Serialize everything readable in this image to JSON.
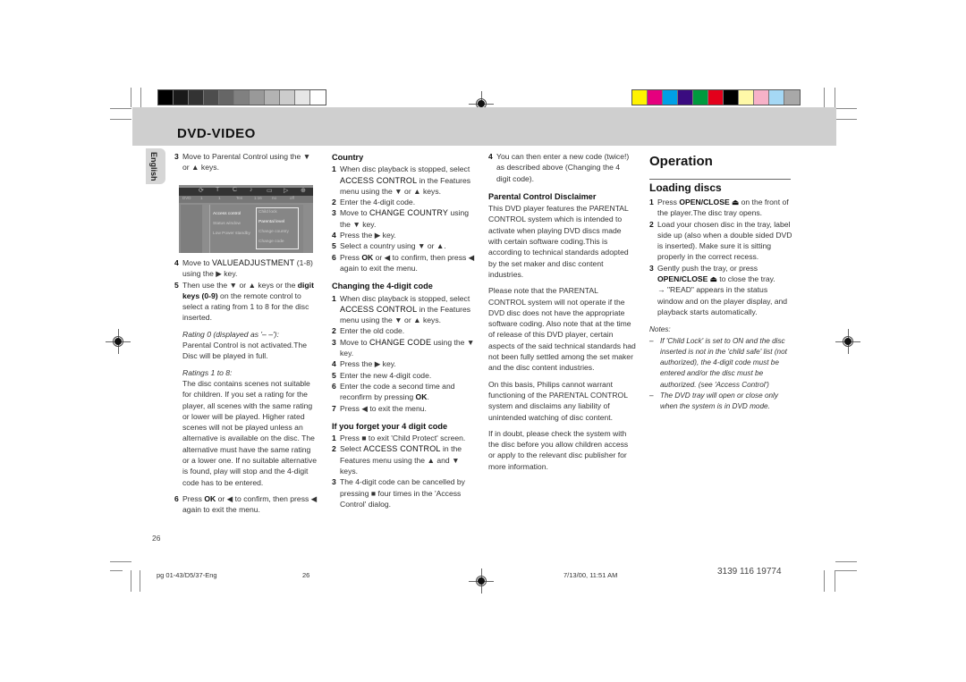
{
  "header": {
    "section_title": "DVD-VIDEO",
    "language_tab": "English",
    "grayscale_swatches": [
      "#000000",
      "#1a1a1a",
      "#333333",
      "#4d4d4d",
      "#666666",
      "#808080",
      "#999999",
      "#b3b3b3",
      "#cccccc",
      "#e6e6e6",
      "#ffffff"
    ],
    "color_swatches": [
      "#fff200",
      "#e5007e",
      "#00a0e6",
      "#3a0b80",
      "#009a3e",
      "#e3001b",
      "#000000",
      "#fff9a8",
      "#f7b2c8",
      "#a5d8f5",
      "#a8a8a8"
    ]
  },
  "col1": {
    "step3": {
      "n": "3",
      "text": "Move to Parental Control using the ▼ or ▲ keys."
    },
    "osd": {
      "top_icons": [
        "⟳",
        "T",
        "C",
        "♪",
        "▭",
        "▷",
        "⊕"
      ],
      "sub_values": [
        "DVD",
        "1",
        "1",
        "Ten",
        "1:16",
        "no",
        "off"
      ],
      "menu_items": [
        "Access control",
        "Status window",
        "Low Power standby"
      ],
      "submenu_items": [
        "Child lock",
        "Parental level",
        "Change country",
        "Change code"
      ],
      "selected_submenu": "Parental level"
    },
    "step4": {
      "n": "4",
      "pre": "Move to ",
      "key": "VALUEADJUSTMENT",
      "post": " (1-8) using the ▶ key."
    },
    "step5": {
      "n": "5",
      "pre": "Then use the ▼ or ▲ keys or the ",
      "key": "digit keys (0-9)",
      "post": " on the remote control to select a rating from 1 to 8 for the disc inserted."
    },
    "rating0_label": "Rating 0 (displayed as '– –'):",
    "rating0_text": "Parental Control is not activated.The Disc will be played in full.",
    "ratings_label": "Ratings 1 to 8:",
    "ratings_text": "The disc contains scenes not suitable for children. If you set a rating for the player, all scenes with the same rating or lower will be played. Higher rated scenes will not be played unless an alternative is available on the disc. The alternative must have the same rating or a lower one. If no suitable alternative is found, play will stop and the 4-digit code has to be entered.",
    "step6": {
      "n": "6",
      "pre": "Press ",
      "key": "OK",
      "post": " or ◀ to confirm, then press ◀ again to exit the menu."
    },
    "page_number": "26"
  },
  "col2": {
    "country_title": "Country",
    "country_steps": [
      {
        "n": "1",
        "pre": "When disc playback is stopped, select ",
        "key": "ACCESS CONTROL",
        "post": " in the Features menu using the ▼ or ▲ keys."
      },
      {
        "n": "2",
        "pre": "Enter the 4-digit code.",
        "key": "",
        "post": ""
      },
      {
        "n": "3",
        "pre": "Move to ",
        "key": "CHANGE COUNTRY",
        "post": " using the ▼ key."
      },
      {
        "n": "4",
        "pre": "Press the ▶ key.",
        "key": "",
        "post": ""
      },
      {
        "n": "5",
        "pre": "Select a country using ▼ or ▲.",
        "key": "",
        "post": ""
      },
      {
        "n": "6",
        "pre": "Press ",
        "key": "OK",
        "post": " or ◀ to confirm, then press ◀ again to exit the menu."
      }
    ],
    "code_title": "Changing the 4-digit code",
    "code_steps": [
      {
        "n": "1",
        "pre": "When disc playback is stopped, select ",
        "key": "ACCESS CONTROL",
        "post": " in the Features menu using the ▼ or ▲ keys."
      },
      {
        "n": "2",
        "pre": "Enter the old code.",
        "key": "",
        "post": ""
      },
      {
        "n": "3",
        "pre": "Move to ",
        "key": "CHANGE CODE",
        "post": " using the ▼ key."
      },
      {
        "n": "4",
        "pre": "Press the ▶ key.",
        "key": "",
        "post": ""
      },
      {
        "n": "5",
        "pre": "Enter the new 4-digit code.",
        "key": "",
        "post": ""
      },
      {
        "n": "6",
        "pre": "Enter the code a second time and reconfirm by pressing ",
        "key": "OK",
        "post": "."
      },
      {
        "n": "7",
        "pre": "Press ◀ to exit the menu.",
        "key": "",
        "post": ""
      }
    ],
    "forget_title": "If you forget your 4 digit code",
    "forget_steps": [
      {
        "n": "1",
        "pre": "Press ■ to exit 'Child Protect' screen.",
        "key": "",
        "post": ""
      },
      {
        "n": "2",
        "pre": "Select ",
        "key": "ACCESS CONTROL",
        "post": " in the Features menu using the ▲ and ▼ keys."
      },
      {
        "n": "3",
        "pre": "The 4-digit code can be cancelled by pressing ■ four times in the 'Access Control' dialog.",
        "key": "",
        "post": ""
      }
    ]
  },
  "col3": {
    "step4": {
      "n": "4",
      "text": "You can then enter a new code (twice!) as described above (Changing the 4 digit code)."
    },
    "disclaimer_title": "Parental Control Disclaimer",
    "para1": "This DVD player features the PARENTAL CONTROL system which is intended to activate when playing DVD discs made with certain software coding.This is according to technical standards adopted by the set maker and disc content industries.",
    "para2": "Please note that the PARENTAL CONTROL system will not operate if the DVD disc does not have the appropriate software coding. Also note that at the time of release of this DVD player, certain aspects of the said technical standards had not been fully settled among the set maker and the disc content industries.",
    "para3": "On this basis, Philips cannot warrant functioning of the PARENTAL CONTROL system and disclaims any liability of unintended watching of disc content.",
    "para4": "If in doubt, please check the system with the disc before you allow children access or apply to the relevant disc publisher for more information."
  },
  "col4": {
    "title": "Operation",
    "subtitle": "Loading discs",
    "steps": [
      {
        "n": "1",
        "pre": "Press ",
        "key": "OPEN/CLOSE ⏏",
        "post": " on the front of the player.The disc tray opens."
      },
      {
        "n": "2",
        "pre": "Load your chosen disc in the tray, label side up (also when a double sided DVD is inserted). Make sure it is sitting properly in the correct recess.",
        "key": "",
        "post": ""
      },
      {
        "n": "3",
        "pre": "Gently push the tray, or press ",
        "key": "OPEN/CLOSE ⏏",
        "post": " to close the tray."
      }
    ],
    "result": "→ \"READ\" appears in the status window and on the player display, and playback starts automatically.",
    "notes_label": "Notes:",
    "notes": [
      "If 'Child Lock' is set to ON and the disc inserted is not in the 'child safe' list (not authorized), the 4-digit code must be entered and/or the disc must be authorized. (see 'Access Control')",
      "The DVD tray will open or close only when the system is in DVD mode."
    ]
  },
  "footer": {
    "file": "pg 01-43/D5/37-Eng",
    "page": "26",
    "date": "7/13/00, 11:51 AM",
    "code": "3139 116 19774"
  }
}
